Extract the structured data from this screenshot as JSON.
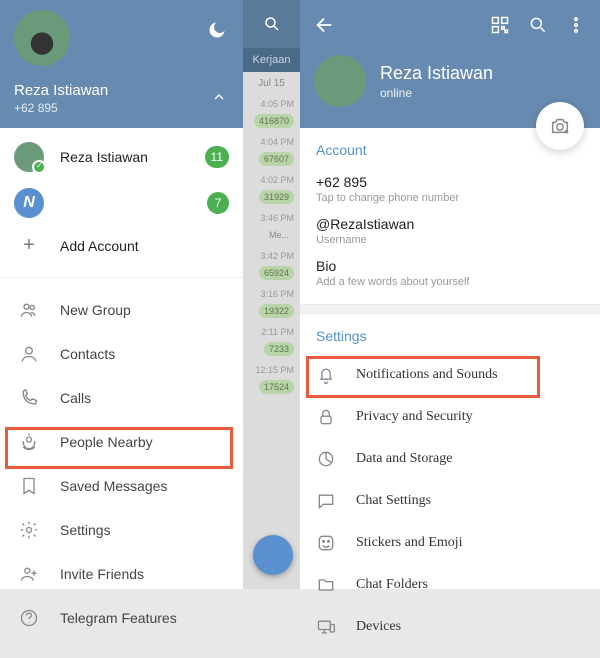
{
  "left": {
    "profile_name": "Reza Istiawan",
    "profile_phone": "+62 895",
    "accounts": [
      {
        "name": "Reza Istiawan",
        "badge": "11"
      },
      {
        "name": "",
        "badge": "7"
      }
    ],
    "add_account": "Add Account",
    "menu": [
      {
        "id": "new-group",
        "label": "New Group"
      },
      {
        "id": "contacts",
        "label": "Contacts"
      },
      {
        "id": "calls",
        "label": "Calls"
      },
      {
        "id": "people-nearby",
        "label": "People Nearby"
      },
      {
        "id": "saved-messages",
        "label": "Saved Messages"
      },
      {
        "id": "settings",
        "label": "Settings"
      },
      {
        "id": "invite-friends",
        "label": "Invite Friends"
      },
      {
        "id": "telegram-features",
        "label": "Telegram Features"
      }
    ]
  },
  "mid": {
    "tab": "Kerjaan",
    "date": "Jul 15",
    "items": [
      {
        "time": "4:05 PM",
        "bubble": "416870"
      },
      {
        "time": "4:04 PM",
        "bubble": "67607"
      },
      {
        "time": "4:02 PM",
        "bubble": "31929"
      },
      {
        "time": "3:46 PM",
        "bubble": "Me..."
      },
      {
        "time": "3:42 PM",
        "bubble": "65924"
      },
      {
        "time": "3:16 PM",
        "bubble": "19322"
      },
      {
        "time": "2:11 PM",
        "bubble": "7233"
      },
      {
        "time": "12:15 PM",
        "bubble": "17524"
      }
    ]
  },
  "right": {
    "name": "Reza Istiawan",
    "status": "online",
    "account": {
      "title": "Account",
      "phone": "+62 895",
      "phone_sub": "Tap to change phone number",
      "username": "@RezaIstiawan",
      "username_sub": "Username",
      "bio": "Bio",
      "bio_sub": "Add a few words about yourself"
    },
    "settings_title": "Settings",
    "settings": [
      {
        "id": "notifications",
        "label": "Notifications and Sounds"
      },
      {
        "id": "privacy",
        "label": "Privacy and Security"
      },
      {
        "id": "data",
        "label": "Data and Storage"
      },
      {
        "id": "chat-settings",
        "label": "Chat Settings"
      },
      {
        "id": "stickers",
        "label": "Stickers and Emoji"
      },
      {
        "id": "chat-folders",
        "label": "Chat Folders"
      },
      {
        "id": "devices",
        "label": "Devices"
      }
    ]
  }
}
